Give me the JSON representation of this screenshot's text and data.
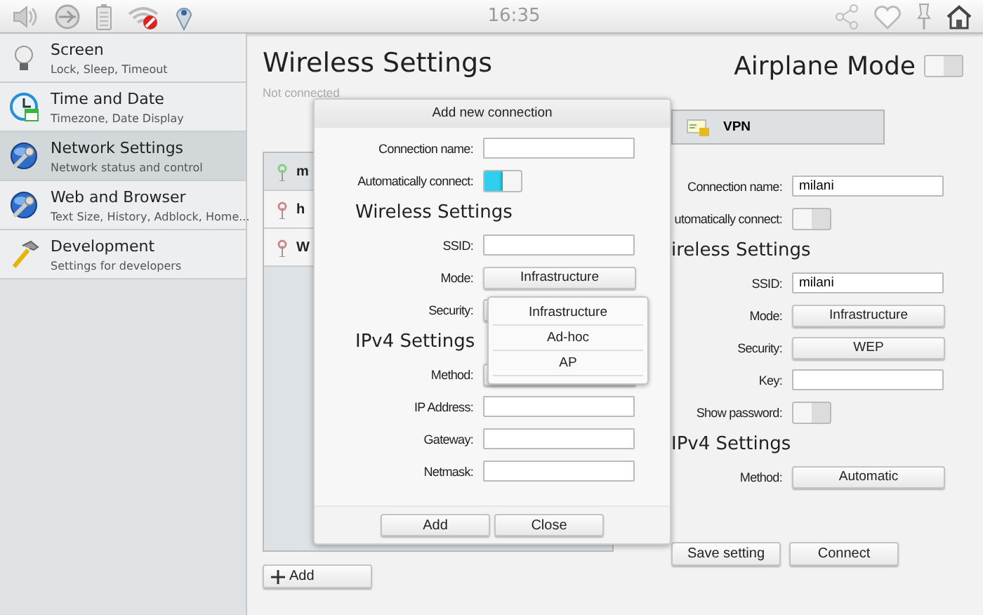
{
  "status_bar": {
    "time": "16:35"
  },
  "sidebar": {
    "items": [
      {
        "title": "Screen",
        "subtitle": "Lock, Sleep, Timeout",
        "selected": false
      },
      {
        "title": "Time and Date",
        "subtitle": "Timezone, Date Display",
        "selected": false
      },
      {
        "title": "Network Settings",
        "subtitle": "Network status and control",
        "selected": true
      },
      {
        "title": "Web and Browser",
        "subtitle": "Text Size, History, Adblock, Home...",
        "selected": false
      },
      {
        "title": "Development",
        "subtitle": "Settings for developers",
        "selected": false
      }
    ]
  },
  "page": {
    "title": "Wireless Settings",
    "status": "Not connected",
    "airplane_mode": {
      "label": "Airplane Mode",
      "on": false
    }
  },
  "networks": [
    {
      "name": "m",
      "selected": true
    },
    {
      "name": "h",
      "selected": false
    },
    {
      "name": "W",
      "selected": false
    }
  ],
  "add_button": "Add",
  "tabs": [
    {
      "label": "VPN",
      "selected": false
    }
  ],
  "form": {
    "rows": [
      {
        "kind": "field",
        "label": "Connection name:",
        "value": "milani"
      },
      {
        "kind": "toggle",
        "label": "utomatically connect:",
        "on": false
      },
      {
        "kind": "heading",
        "text": "ireless Settings"
      },
      {
        "kind": "field",
        "label": "SSID:",
        "value": "milani"
      },
      {
        "kind": "select",
        "label": "Mode:",
        "value": "Infrastructure"
      },
      {
        "kind": "select",
        "label": "Security:",
        "value": "WEP"
      },
      {
        "kind": "field",
        "label": "Key:"
      },
      {
        "kind": "toggle",
        "label": "Show password:",
        "on": false
      },
      {
        "kind": "heading",
        "text": "IPv4 Settings"
      },
      {
        "kind": "select",
        "label": "Method:",
        "value": "Automatic"
      }
    ],
    "buttons": [
      "Save setting",
      "Connect"
    ]
  },
  "dialog": {
    "title": "Add new connection",
    "rows": [
      {
        "kind": "field",
        "label": "Connection name:"
      },
      {
        "kind": "toggle",
        "label": "Automatically connect:",
        "on": true
      },
      {
        "kind": "heading",
        "text": "Wireless Settings"
      },
      {
        "kind": "field",
        "label": "SSID:"
      },
      {
        "kind": "select",
        "label": "Mode:",
        "value": "Infrastructure"
      },
      {
        "kind": "select",
        "label": "Security:"
      },
      {
        "kind": "heading",
        "text": "IPv4 Settings"
      },
      {
        "kind": "select",
        "label": "Method:"
      },
      {
        "kind": "field",
        "label": "IP Address:"
      },
      {
        "kind": "field",
        "label": "Gateway:"
      },
      {
        "kind": "field",
        "label": "Netmask:"
      }
    ],
    "buttons": [
      "Add",
      "Close"
    ]
  },
  "dropdown": {
    "options": [
      "Infrastructure",
      "Ad-hoc",
      "AP"
    ]
  }
}
